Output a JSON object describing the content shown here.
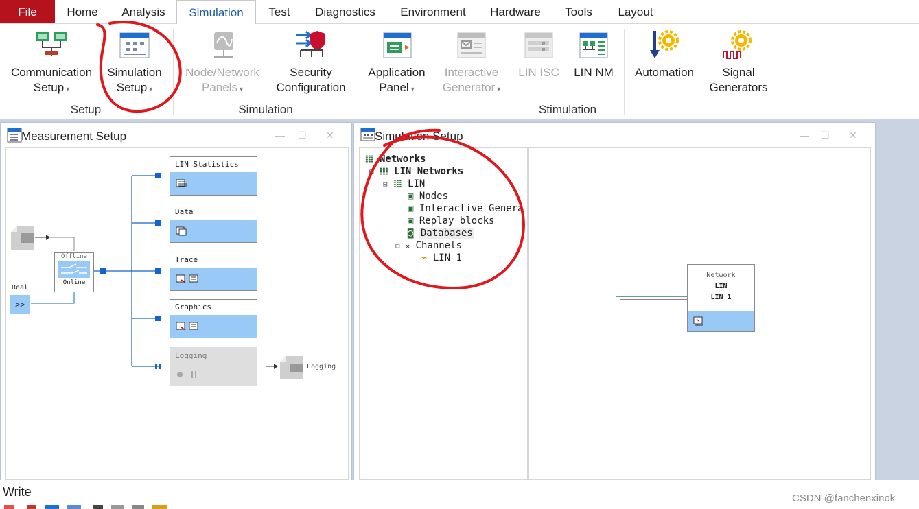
{
  "menu": {
    "tabs": [
      {
        "label": "File"
      },
      {
        "label": "Home"
      },
      {
        "label": "Analysis"
      },
      {
        "label": "Simulation"
      },
      {
        "label": "Test"
      },
      {
        "label": "Diagnostics"
      },
      {
        "label": "Environment"
      },
      {
        "label": "Hardware"
      },
      {
        "label": "Tools"
      },
      {
        "label": "Layout"
      }
    ]
  },
  "ribbon": {
    "buttons": [
      {
        "line1": "Communication",
        "line2": "Setup",
        "icon": "communication-setup-icon"
      },
      {
        "line1": "Simulation",
        "line2": "Setup",
        "icon": "simulation-setup-icon"
      },
      {
        "line1": "Node/Network",
        "line2": "Panels",
        "icon": "node-network-panels-icon"
      },
      {
        "line1": "Security",
        "line2": "Configuration",
        "icon": "security-configuration-icon"
      },
      {
        "line1": "Application",
        "line2": "Panel",
        "icon": "application-panel-icon"
      },
      {
        "line1": "Interactive",
        "line2": "Generator",
        "icon": "interactive-generator-icon"
      },
      {
        "line1": "LIN ISC",
        "icon": "lin-isc-icon"
      },
      {
        "line1": "LIN NM",
        "icon": "lin-nm-icon"
      },
      {
        "line1": "Automation",
        "icon": "automation-icon"
      },
      {
        "line1": "Signal",
        "line2": "Generators",
        "icon": "signal-generators-icon"
      }
    ],
    "groups": [
      "Setup",
      "Simulation",
      "Stimulation"
    ]
  },
  "measurement": {
    "title": "Measurement Setup",
    "offline": "Offline",
    "online": "Online",
    "real": "Real",
    "real_symbol": ">>",
    "blocks": [
      "LIN Statistics",
      "Data",
      "Trace",
      "Graphics",
      "Logging"
    ],
    "logging_target": "Logging"
  },
  "simulation": {
    "title": "Simulation Setup",
    "tree": [
      {
        "label": "Networks",
        "expander": ""
      },
      {
        "label": "LIN Networks",
        "expander": "⊟"
      },
      {
        "label": "LIN",
        "expander": "⊟"
      },
      {
        "label": "Nodes",
        "expander": ""
      },
      {
        "label": "Interactive Genera",
        "expander": ""
      },
      {
        "label": "Replay blocks",
        "expander": ""
      },
      {
        "label": "Databases",
        "expander": ""
      },
      {
        "label": "Channels",
        "expander": "⊟"
      },
      {
        "label": "LIN 1",
        "expander": ""
      }
    ],
    "network_block": {
      "header": "Network",
      "line1": "LIN",
      "line2": "LIN 1"
    }
  },
  "status": {
    "write_label": "Write",
    "watermark": "CSDN @fanchenxinok"
  },
  "colors": {
    "file_tab": "#b5121b",
    "active_tab_text": "#1f5fa8",
    "block_fill": "#99c9f7",
    "connector": "#1464c8",
    "annotation": "#e0181e"
  }
}
